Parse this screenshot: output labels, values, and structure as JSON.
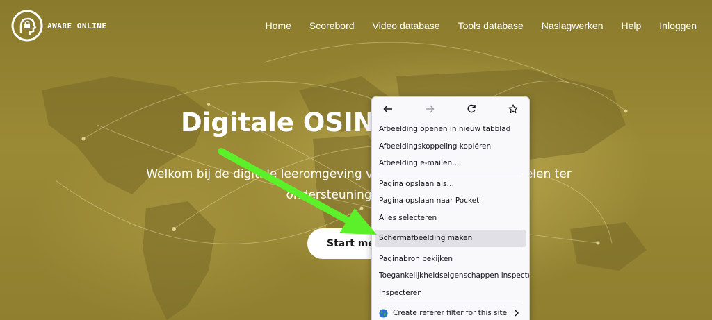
{
  "brand": {
    "name": "AWARE ONLINE"
  },
  "nav": {
    "items": [
      {
        "label": "Home"
      },
      {
        "label": "Scorebord"
      },
      {
        "label": "Video database"
      },
      {
        "label": "Tools database"
      },
      {
        "label": "Naslagwerken"
      },
      {
        "label": "Help"
      },
      {
        "label": "Inloggen"
      }
    ]
  },
  "hero": {
    "title": "Digitale OSINT l",
    "text": "Welkom bij de digitale leeromgeving van Aware Online leermiddelen ter ondersteuning van uw tr",
    "cta_label": "Start met l"
  },
  "context_menu": {
    "nav_icons": [
      "back-arrow-icon",
      "forward-arrow-icon",
      "reload-icon",
      "bookmark-star-icon"
    ],
    "group1": [
      {
        "label": "Afbeelding openen in nieuw tabblad"
      },
      {
        "label": "Afbeeldingskoppeling kopiëren"
      },
      {
        "label": "Afbeelding e-mailen…"
      }
    ],
    "group2": [
      {
        "label": "Pagina opslaan als…"
      },
      {
        "label": "Pagina opslaan naar Pocket"
      },
      {
        "label": "Alles selecteren"
      }
    ],
    "highlighted": {
      "label": "Schermafbeelding maken"
    },
    "group3": [
      {
        "label": "Paginabron bekijken"
      },
      {
        "label": "Toegankelijkheidseigenschappen inspecteren"
      },
      {
        "label": "Inspecteren"
      }
    ],
    "extension": {
      "label": "Create referer filter for this site",
      "icon": "globe-icon"
    }
  },
  "colors": {
    "hero_overlay": "#8e7e2c",
    "arrow": "#5cf02a",
    "menu_bg": "#f9f9fb",
    "menu_highlight": "#e0e0e6"
  }
}
